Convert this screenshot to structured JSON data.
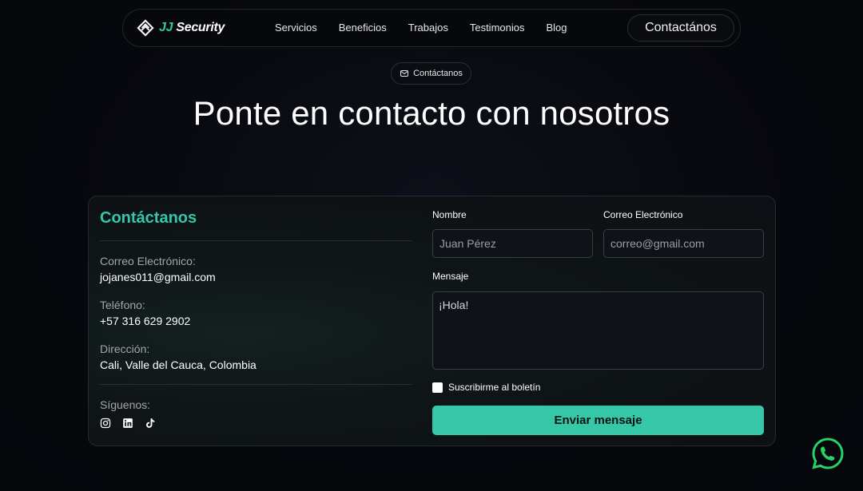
{
  "nav": {
    "logo_jj": "JJ",
    "logo_security": "Security",
    "links": [
      "Servicios",
      "Beneficios",
      "Trabajos",
      "Testimonios",
      "Blog"
    ],
    "cta": "Contactános"
  },
  "hero": {
    "badge": "Contáctanos",
    "title": "Ponte en contacto con nosotros"
  },
  "info": {
    "title": "Contáctanos",
    "email_label": "Correo Electrónico:",
    "email_value": "jojanes011@gmail.com",
    "phone_label": "Teléfono:",
    "phone_value": "+57 316 629 2902",
    "address_label": "Dirección:",
    "address_value": "Cali, Valle del Cauca, Colombia",
    "follow_label": "Síguenos:",
    "socials": [
      "instagram-icon",
      "linkedin-icon",
      "tiktok-icon"
    ]
  },
  "form": {
    "name_label": "Nombre",
    "name_placeholder": "Juan Pérez",
    "email_label": "Correo Electrónico",
    "email_placeholder": "correo@gmail.com",
    "message_label": "Mensaje",
    "message_value": "¡Hola!",
    "newsletter_label": "Suscribirme al boletín",
    "submit_label": "Enviar mensaje"
  },
  "colors": {
    "accent": "#35c7a8",
    "background": "#07080d",
    "whatsapp": "#25d366"
  }
}
